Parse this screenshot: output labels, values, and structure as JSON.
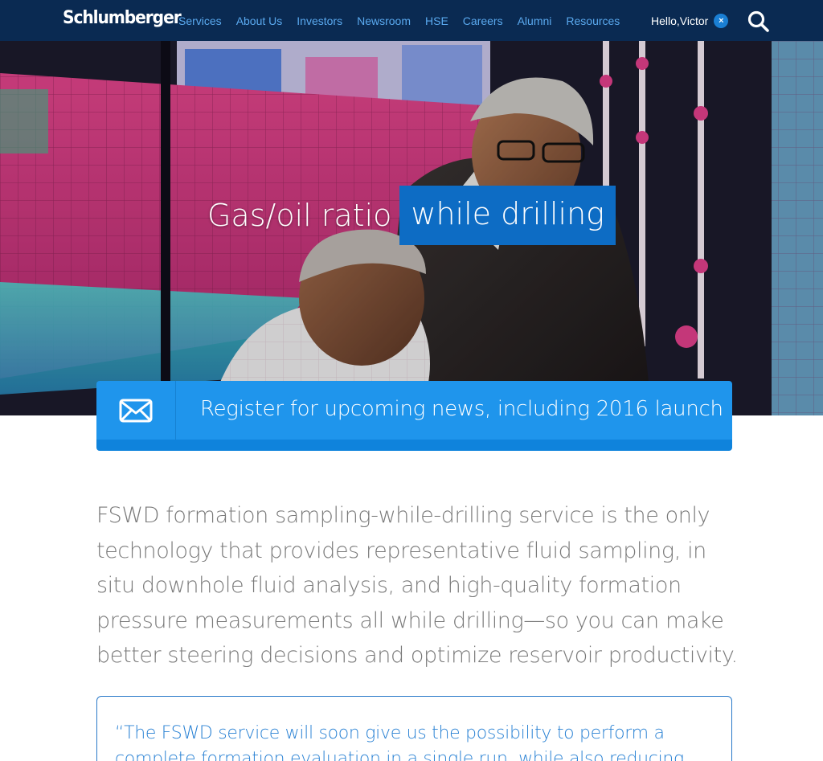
{
  "nav": {
    "logo": "Schlumberger",
    "links": [
      "Services",
      "About Us",
      "Investors",
      "Newsroom",
      "HSE",
      "Careers",
      "Alumni",
      "Resources"
    ],
    "greeting": "Hello,Victor",
    "close_glyph": "×",
    "search_icon": "search-icon"
  },
  "hero": {
    "title_part1": "Gas/oil ratio",
    "title_part2": "while drilling"
  },
  "register": {
    "icon": "envelope-icon",
    "text": "Register for upcoming news, including 2016 launch"
  },
  "intro": {
    "text": "FSWD formation sampling-while-drilling service is the only technology that provides representative fluid sampling, in situ downhole fluid analysis, and high-quality formation pressure measurements all while drilling—so you can make better steering decisions and optimize reservoir productivity."
  },
  "quote": {
    "text": "“The FSWD service will soon give us the possibility to perform a complete formation evaluation in a single run, while also reducing acquisition time"
  },
  "colors": {
    "nav_bg": "#0a2a52",
    "nav_link": "#5aa9ef",
    "accent": "#1f95ec",
    "title_highlight": "#0d6cc4",
    "body_text": "#7a7a7a",
    "quote_text": "#2a82d4"
  }
}
